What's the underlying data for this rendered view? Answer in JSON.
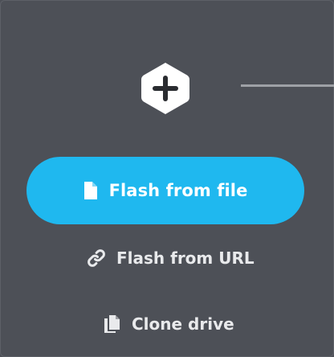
{
  "step": {
    "icon": "hexagon-plus-icon",
    "icon_color": "#ffffff",
    "glyph_color": "#2a2c30"
  },
  "actions": {
    "flash_file_label": "Flash from file",
    "flash_url_label": "Flash from URL",
    "clone_drive_label": "Clone drive",
    "flash_file_icon": "file-icon",
    "flash_url_icon": "link-icon",
    "clone_drive_icon": "copy-icon"
  },
  "colors": {
    "background": "#4d5057",
    "primary_button": "#1fb8ef",
    "text_light": "#e9eaec",
    "connector": "#9ea1a6"
  }
}
